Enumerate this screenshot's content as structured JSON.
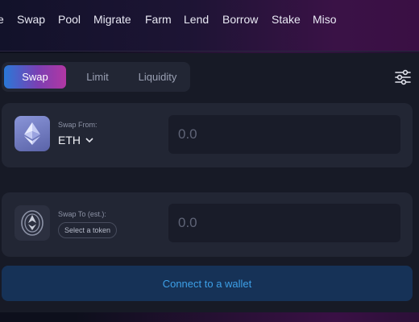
{
  "nav": {
    "items": [
      {
        "label": "e"
      },
      {
        "label": "Swap"
      },
      {
        "label": "Pool"
      },
      {
        "label": "Migrate"
      },
      {
        "label": "Farm"
      },
      {
        "label": "Lend"
      },
      {
        "label": "Borrow"
      },
      {
        "label": "Stake"
      },
      {
        "label": "Miso"
      }
    ]
  },
  "tabs": [
    {
      "label": "Swap",
      "active": true
    },
    {
      "label": "Limit",
      "active": false
    },
    {
      "label": "Liquidity",
      "active": false
    }
  ],
  "settings_icon": "sliders-icon",
  "swap_from": {
    "label": "Swap From:",
    "token": "ETH",
    "token_icon": "ethereum-icon",
    "amount_placeholder": "0.0"
  },
  "swap_to": {
    "label": "Swap To (est.):",
    "select_label": "Select a token",
    "token_icon": "ethereum-outline-icon",
    "amount_placeholder": "0.0"
  },
  "swap_direction_icon": "swap-arrows-icon",
  "connect_button": {
    "label": "Connect to a wallet"
  },
  "colors": {
    "accent_blue": "#2978d7",
    "accent_purple": "#b237a3",
    "connect_text": "#3da0e8",
    "connect_bg": "#163257",
    "card_bg": "#222634"
  }
}
